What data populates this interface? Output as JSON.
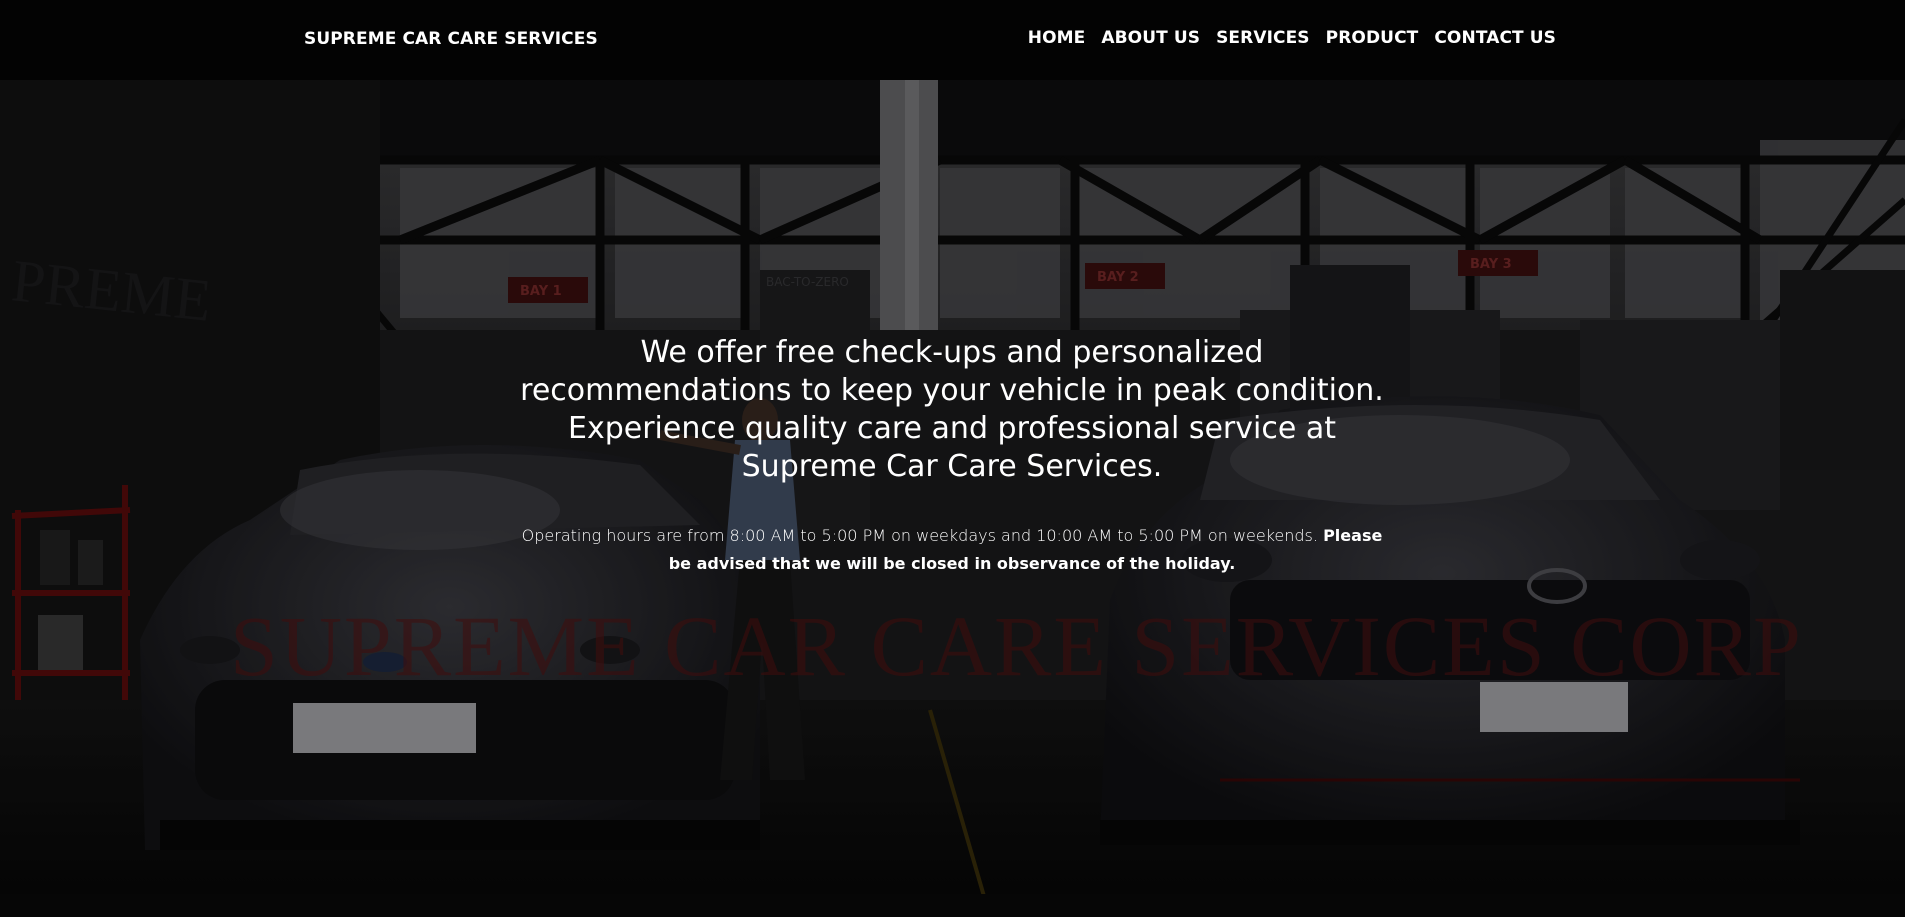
{
  "navbar": {
    "brand": "SUPREME CAR CARE SERVICES",
    "links": [
      "HOME",
      "ABOUT US",
      "SERVICES",
      "PRODUCT",
      "CONTACT US"
    ]
  },
  "hero": {
    "headline": "We offer free check-ups and personalized recommendations to keep your vehicle in peak condition. Experience quality care and professional service at Supreme Car Care Services.",
    "hours_text": "Operating hours are from 8:00 AM to 5:00 PM on weekdays and 10:00 AM to 5:00 PM on weekends.",
    "notice_text": "Please be advised that we will be closed in observance of the holiday.",
    "watermark": "SUPREME CAR CARE SERVICES CORP",
    "wall_sign": "PREME",
    "bay_signs": [
      "BAY 1",
      "BAY 2",
      "BAY 3"
    ],
    "banner_text": "BAC-TO-ZERO"
  },
  "colors": {
    "nav_bg": "#030303",
    "text": "#ffffff",
    "watermark": "#5a1212"
  }
}
